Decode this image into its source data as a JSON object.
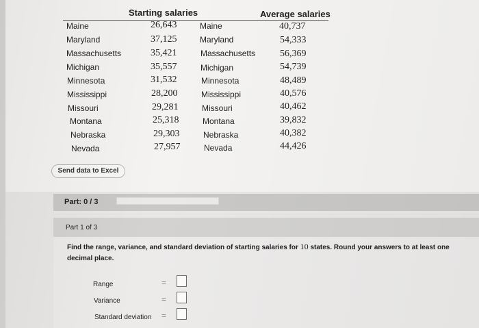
{
  "table": {
    "starting_header": "Starting salaries",
    "average_header": "Average salaries",
    "starting": [
      {
        "state": "Maine",
        "value": "26,643"
      },
      {
        "state": "Maryland",
        "value": "37,125"
      },
      {
        "state": "Massachusetts",
        "value": "35,421"
      },
      {
        "state": "Michigan",
        "value": "35,557"
      },
      {
        "state": "Minnesota",
        "value": "31,532"
      },
      {
        "state": "Mississippi",
        "value": "28,200"
      },
      {
        "state": "Missouri",
        "value": "29,281"
      },
      {
        "state": "Montana",
        "value": "25,318"
      },
      {
        "state": "Nebraska",
        "value": "29,303"
      },
      {
        "state": "Nevada",
        "value": "27,957"
      }
    ],
    "average": [
      {
        "state": "Maine",
        "value": "40,737"
      },
      {
        "state": "Maryland",
        "value": "54,333"
      },
      {
        "state": "Massachusetts",
        "value": "56,369"
      },
      {
        "state": "Michigan",
        "value": "54,739"
      },
      {
        "state": "Minnesota",
        "value": "48,489"
      },
      {
        "state": "Mississippi",
        "value": "40,576"
      },
      {
        "state": "Missouri",
        "value": "40,462"
      },
      {
        "state": "Montana",
        "value": "39,832"
      },
      {
        "state": "Nebraska",
        "value": "40,382"
      },
      {
        "state": "Nevada",
        "value": "44,426"
      }
    ]
  },
  "send_excel_label": "Send data to Excel",
  "part_progress": {
    "label": "Part:",
    "value": "0 / 3",
    "fraction": 0
  },
  "part_of": "Part 1 of 3",
  "question": {
    "before": "Find the range, variance, and standard deviation of starting salaries for",
    "number": "10",
    "after": "states. Round your answers to at least one decimal place."
  },
  "answers": {
    "range_label": "Range",
    "variance_label": "Variance",
    "sd_label": "Standard deviation",
    "eq_sign": "="
  }
}
